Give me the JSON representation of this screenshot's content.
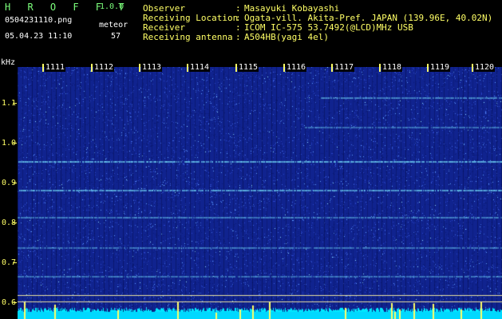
{
  "app": {
    "brand": "H R O F F T",
    "version": "1.0.0",
    "filename": "0504231110.png",
    "datetime": "05.04.23 11:10",
    "mode_label": "meteor",
    "meteor_count": "57"
  },
  "station": {
    "rows": [
      {
        "label": "Observer",
        "value": "Masayuki Kobayashi"
      },
      {
        "label": "Receiving Location",
        "value": "Ogata-vill. Akita-Pref. JAPAN (139.96E, 40.02N)"
      },
      {
        "label": "Receiver",
        "value": "ICOM IC-575 53.7492(@LCD)MHz USB"
      },
      {
        "label": "Receiving antenna",
        "value": "A504HB(yagi 4el)"
      }
    ],
    "colon": ":"
  },
  "axis": {
    "y_unit": "kHz",
    "y_ticks": [
      "1.1",
      "1.0",
      "0.9",
      "0.8",
      "0.7",
      "0.6"
    ],
    "x_ticks": [
      "1111",
      "1112",
      "1113",
      "1114",
      "1115",
      "1116",
      "1117",
      "1118",
      "1119",
      "1120"
    ]
  },
  "colors": {
    "accent_green": "#7CFF7C",
    "tick_yellow": "#FFFF66",
    "background": "#000000",
    "spectrogram_blue": "#1A2FA0",
    "signal_cyan": "#00E5FF"
  }
}
